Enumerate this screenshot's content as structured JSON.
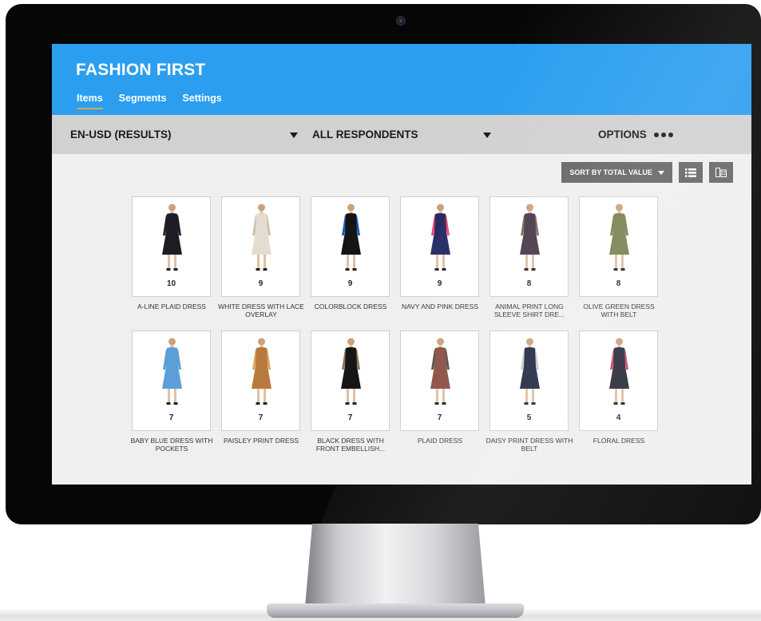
{
  "app": {
    "title": "FASHION FIRST",
    "brand_color": "#2B9EF0",
    "tab_accent": "#F2A23A"
  },
  "tabs": [
    {
      "label": "Items",
      "active": true
    },
    {
      "label": "Segments",
      "active": false
    },
    {
      "label": "Settings",
      "active": false
    }
  ],
  "filters": {
    "locale": "EN-USD (RESULTS)",
    "respondents": "ALL RESPONDENTS",
    "options_label": "OPTIONS"
  },
  "toolbar": {
    "sort_label": "SORT BY TOTAL VALUE",
    "list_view_icon": "list-view-icon",
    "grid_view_icon": "grid-view-icon"
  },
  "items": [
    {
      "name": "A-LINE PLAID DRESS",
      "score": "10",
      "dress_color": "#1d1d26",
      "accent": "#1d1d26"
    },
    {
      "name": "WHITE DRESS WITH LACE OVERLAY",
      "score": "9",
      "dress_color": "#e4dcd3",
      "accent": "#cdbfae"
    },
    {
      "name": "COLORBLOCK DRESS",
      "score": "9",
      "dress_color": "#141414",
      "accent": "#1f58c2"
    },
    {
      "name": "NAVY AND PINK DRESS",
      "score": "9",
      "dress_color": "#262c63",
      "accent": "#f0486a"
    },
    {
      "name": "ANIMAL PRINT LONG SLEEVE SHIRT DRE...",
      "score": "8",
      "dress_color": "#4a3a4a",
      "accent": "#7a6a5a"
    },
    {
      "name": "OLIVE GREEN DRESS WITH BELT",
      "score": "8",
      "dress_color": "#7a8050",
      "accent": "#7a8050"
    },
    {
      "name": "BABY BLUE DRESS WITH POCKETS",
      "score": "7",
      "dress_color": "#5b9fd6",
      "accent": "#5b9fd6"
    },
    {
      "name": "PAISLEY PRINT DRESS",
      "score": "7",
      "dress_color": "#b77a3c",
      "accent": "#d7a65a"
    },
    {
      "name": "BLACK DRESS WITH FRONT EMBELLISH...",
      "score": "7",
      "dress_color": "#161616",
      "accent": "#8a7a5a"
    },
    {
      "name": "PLAID DRESS",
      "score": "7",
      "dress_color": "#8a4e42",
      "accent": "#5a4a4a"
    },
    {
      "name": "DAISY PRINT DRESS WITH BELT",
      "score": "5",
      "dress_color": "#1f2740",
      "accent": "#c8c8c8"
    },
    {
      "name": "FLORAL DRESS",
      "score": "4",
      "dress_color": "#2a2a3a",
      "accent": "#d04a62"
    }
  ]
}
